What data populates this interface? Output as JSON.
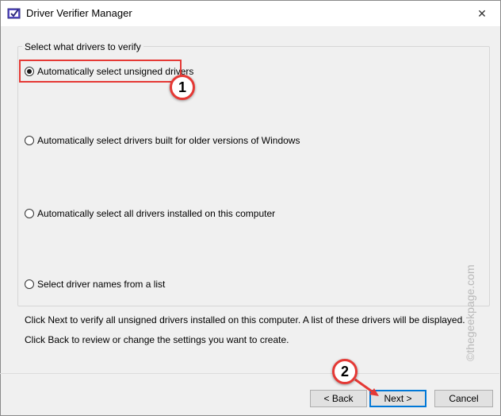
{
  "window": {
    "title": "Driver Verifier Manager",
    "close_symbol": "✕"
  },
  "group": {
    "title": "Select what drivers to verify",
    "options": [
      {
        "label": "Automatically select unsigned drivers",
        "selected": true
      },
      {
        "label": "Automatically select drivers built for older versions of Windows",
        "selected": false
      },
      {
        "label": "Automatically select all drivers installed on this computer",
        "selected": false
      },
      {
        "label": "Select driver names from a list",
        "selected": false
      }
    ]
  },
  "info": {
    "line1": "Click Next to verify all unsigned drivers installed on this computer. A list of these drivers will be displayed.",
    "line2": "Click Back to review or change the settings you want to create."
  },
  "buttons": {
    "back": "< Back",
    "next": "Next >",
    "cancel": "Cancel"
  },
  "annotations": {
    "step1": "1",
    "step2": "2",
    "color": "#e53935"
  },
  "watermark": "©thegeekpage.com",
  "icons": {
    "app": "driver-verifier-icon",
    "close": "close-icon"
  }
}
